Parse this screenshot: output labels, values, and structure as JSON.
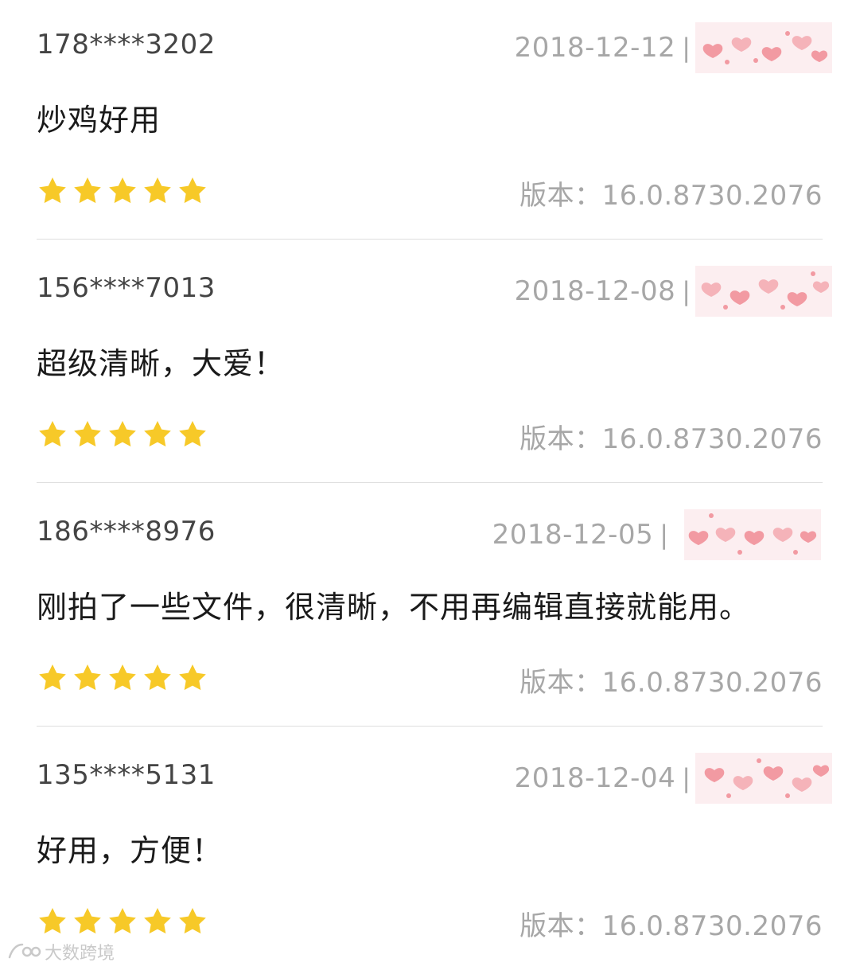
{
  "reviews": [
    {
      "user": "178****3202",
      "date": "2018-12-12",
      "separator": "|",
      "content": "炒鸡好用",
      "rating": 5,
      "rating_max": 5,
      "version": "版本：16.0.8730.2076"
    },
    {
      "user": "156****7013",
      "date": "2018-12-08",
      "separator": "|",
      "content": "超级清晰，大爱！",
      "rating": 5,
      "rating_max": 5,
      "version": "版本：16.0.8730.2076"
    },
    {
      "user": "186****8976",
      "date": "2018-12-05",
      "separator": "|",
      "content": "刚拍了一些文件，很清晰，不用再编辑直接就能用。",
      "rating": 5,
      "rating_max": 5,
      "version": "版本：16.0.8730.2076"
    },
    {
      "user": "135****5131",
      "date": "2018-12-04",
      "separator": "|",
      "content": "好用，方便！",
      "rating": 5,
      "rating_max": 5,
      "version": "版本：16.0.8730.2076"
    }
  ],
  "watermark": {
    "text": "大数跨境"
  },
  "icons": {
    "star": "star-icon",
    "redaction": "heart-sticker-icon",
    "watermark": "logo-icon"
  },
  "colors": {
    "star": "#f7c928",
    "text_primary": "#1a1a1a",
    "text_secondary": "#a7a7a7",
    "username": "#444444",
    "divider": "#dedede",
    "heart": "#f29aa2"
  }
}
